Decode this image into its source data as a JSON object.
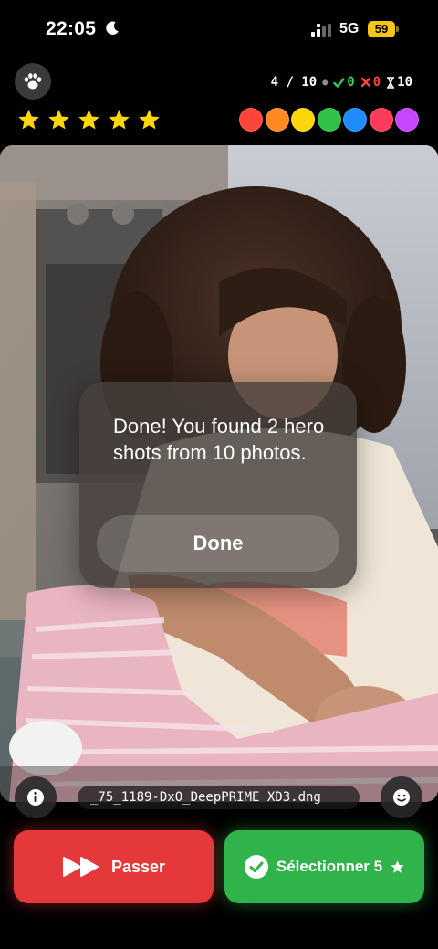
{
  "status_bar": {
    "time": "22:05",
    "network": "5G",
    "battery": "59",
    "icons": [
      "moon-icon",
      "signal-icon",
      "battery-icon"
    ]
  },
  "header": {
    "paw_icon": "paw-icon",
    "progress": "4 / 10",
    "selected_count": "0",
    "rejected_count": "0",
    "remaining_count": "10",
    "rating_stars": 5,
    "color_labels": [
      "#ff453a",
      "#ff8a1f",
      "#ffd60a",
      "#30c048",
      "#1e8cff",
      "#ff3b5c",
      "#c845ff"
    ]
  },
  "dialog": {
    "message": "Done! You found 2 hero shots from 10 photos.",
    "button_label": "Done"
  },
  "photo": {
    "filename": "_75_1189-DxO_DeepPRIME XD3.dng"
  },
  "actions": {
    "skip_label": "Passer",
    "select_label": "Sélectionner 5",
    "skip_color": "#e5383b",
    "select_color": "#2fb34a"
  }
}
